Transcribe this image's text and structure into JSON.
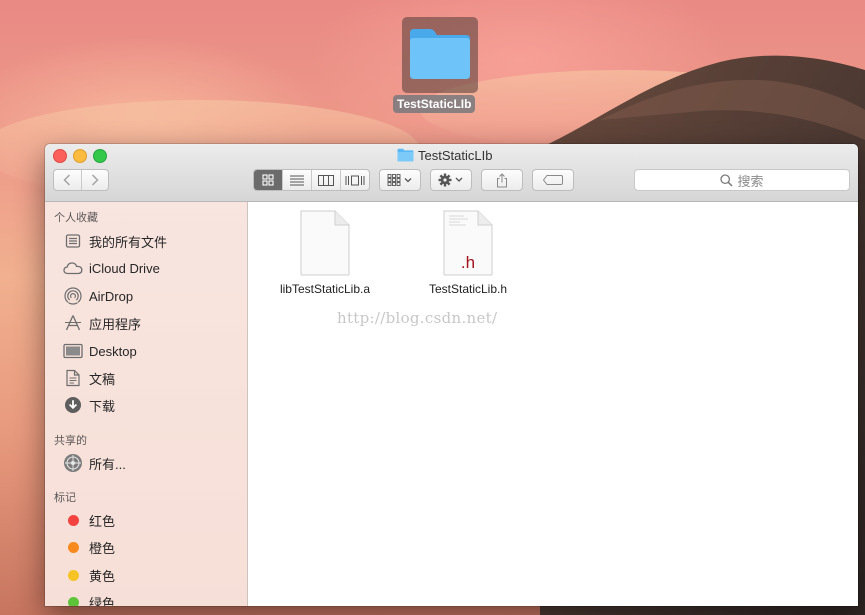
{
  "desktop": {
    "folder_label": "TestStaticLIb"
  },
  "window": {
    "title": "TestStaticLIb",
    "search_placeholder": "搜索"
  },
  "sidebar": {
    "favorites_header": "个人收藏",
    "favorites": [
      {
        "label": "我的所有文件",
        "icon": "all-files-icon"
      },
      {
        "label": "iCloud Drive",
        "icon": "cloud-icon"
      },
      {
        "label": "AirDrop",
        "icon": "airdrop-icon"
      },
      {
        "label": "应用程序",
        "icon": "applications-icon"
      },
      {
        "label": "Desktop",
        "icon": "desktop-icon"
      },
      {
        "label": "文稿",
        "icon": "documents-icon"
      },
      {
        "label": "下载",
        "icon": "downloads-icon"
      }
    ],
    "shared_header": "共享的",
    "shared": [
      {
        "label": "所有...",
        "icon": "network-icon"
      }
    ],
    "tags_header": "标记",
    "tags": [
      {
        "label": "红色",
        "color": "#f3423f"
      },
      {
        "label": "橙色",
        "color": "#f7891d"
      },
      {
        "label": "黄色",
        "color": "#f6c325"
      },
      {
        "label": "绿色",
        "color": "#5dc43a"
      }
    ]
  },
  "files": [
    {
      "name": "libTestStaticLib.a",
      "icon": "blank-document-icon",
      "badge": ""
    },
    {
      "name": "TestStaticLib.h",
      "icon": "header-document-icon",
      "badge": ".h"
    }
  ],
  "watermark": "http://blog.csdn.net/",
  "colors": {
    "folder_blue": "#5ab8f5",
    "header_badge": "#a3131d",
    "active_view": "#6b6b6b"
  }
}
